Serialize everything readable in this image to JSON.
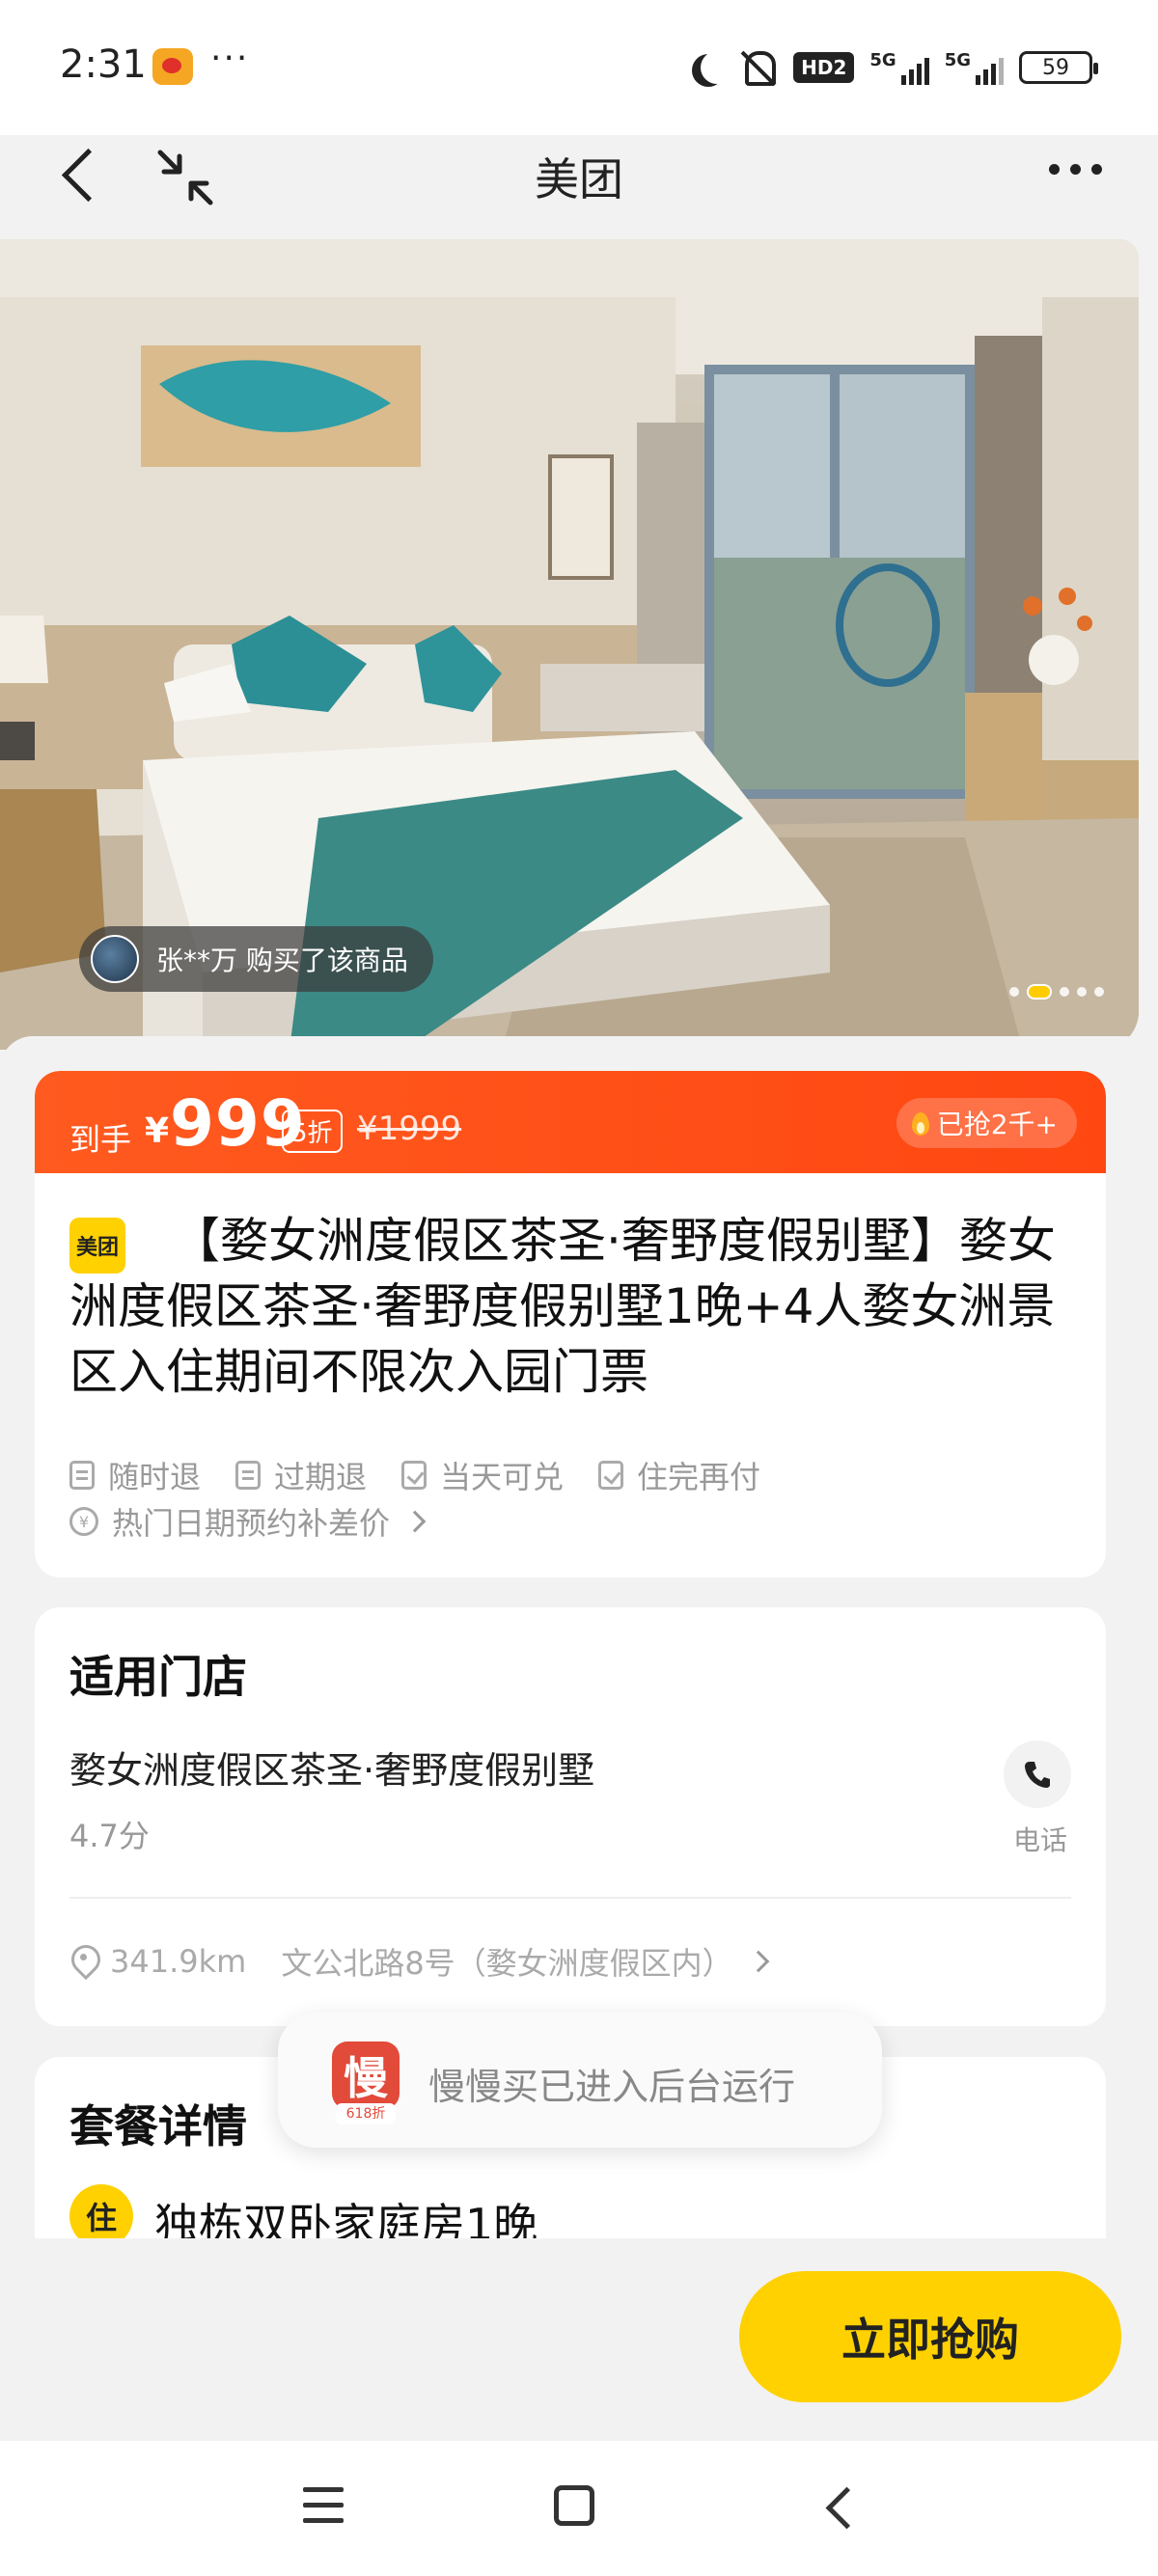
{
  "status_bar": {
    "time": "2:31",
    "more": "···",
    "hd_label": "HD2",
    "signal_label_1": "5G",
    "signal_label_2": "5G",
    "battery": "59",
    "icons": [
      "weibo-icon",
      "moon-icon",
      "mute-icon",
      "signal-icon",
      "battery-icon"
    ]
  },
  "nav": {
    "title": "美团",
    "icons": [
      "back-icon",
      "shrink-icon",
      "more-icon"
    ]
  },
  "hero": {
    "buyer_text": "张**万 购买了该商品",
    "slide_count": 5,
    "active_slide": 2
  },
  "price": {
    "prefix": "到手",
    "currency": "¥",
    "current": "999",
    "discount": "5折",
    "original": "¥1999",
    "sold": "已抢2千+"
  },
  "product": {
    "badge": "美团",
    "title": "【婺女洲度假区茶圣·奢野度假别墅】婺女洲度假区茶圣·奢野度假别墅1晚+4人婺女洲景区入住期间不限次入园门票",
    "tags": [
      "随时退",
      "过期退",
      "当天可兑",
      "住完再付"
    ],
    "hot_text": "热门日期预约补差价"
  },
  "store": {
    "section_title": "适用门店",
    "name": "婺女洲度假区茶圣·奢野度假别墅",
    "rating": "4.7分",
    "phone_label": "电话",
    "distance": "341.9km",
    "address": "文公北路8号（婺女洲度假区内）"
  },
  "package": {
    "section_title": "套餐详情",
    "item_badge": "住",
    "item_name": "独栋双卧家庭房1晚"
  },
  "toast": {
    "app_icon_char": "慢",
    "app_icon_sub": "618折",
    "text": "慢慢买已进入后台运行"
  },
  "actions": {
    "buy_label": "立即抢购"
  },
  "colors": {
    "brand_yellow": "#ffd100",
    "price_orange": "#ff4f16",
    "toast_red": "#e24a3a"
  }
}
